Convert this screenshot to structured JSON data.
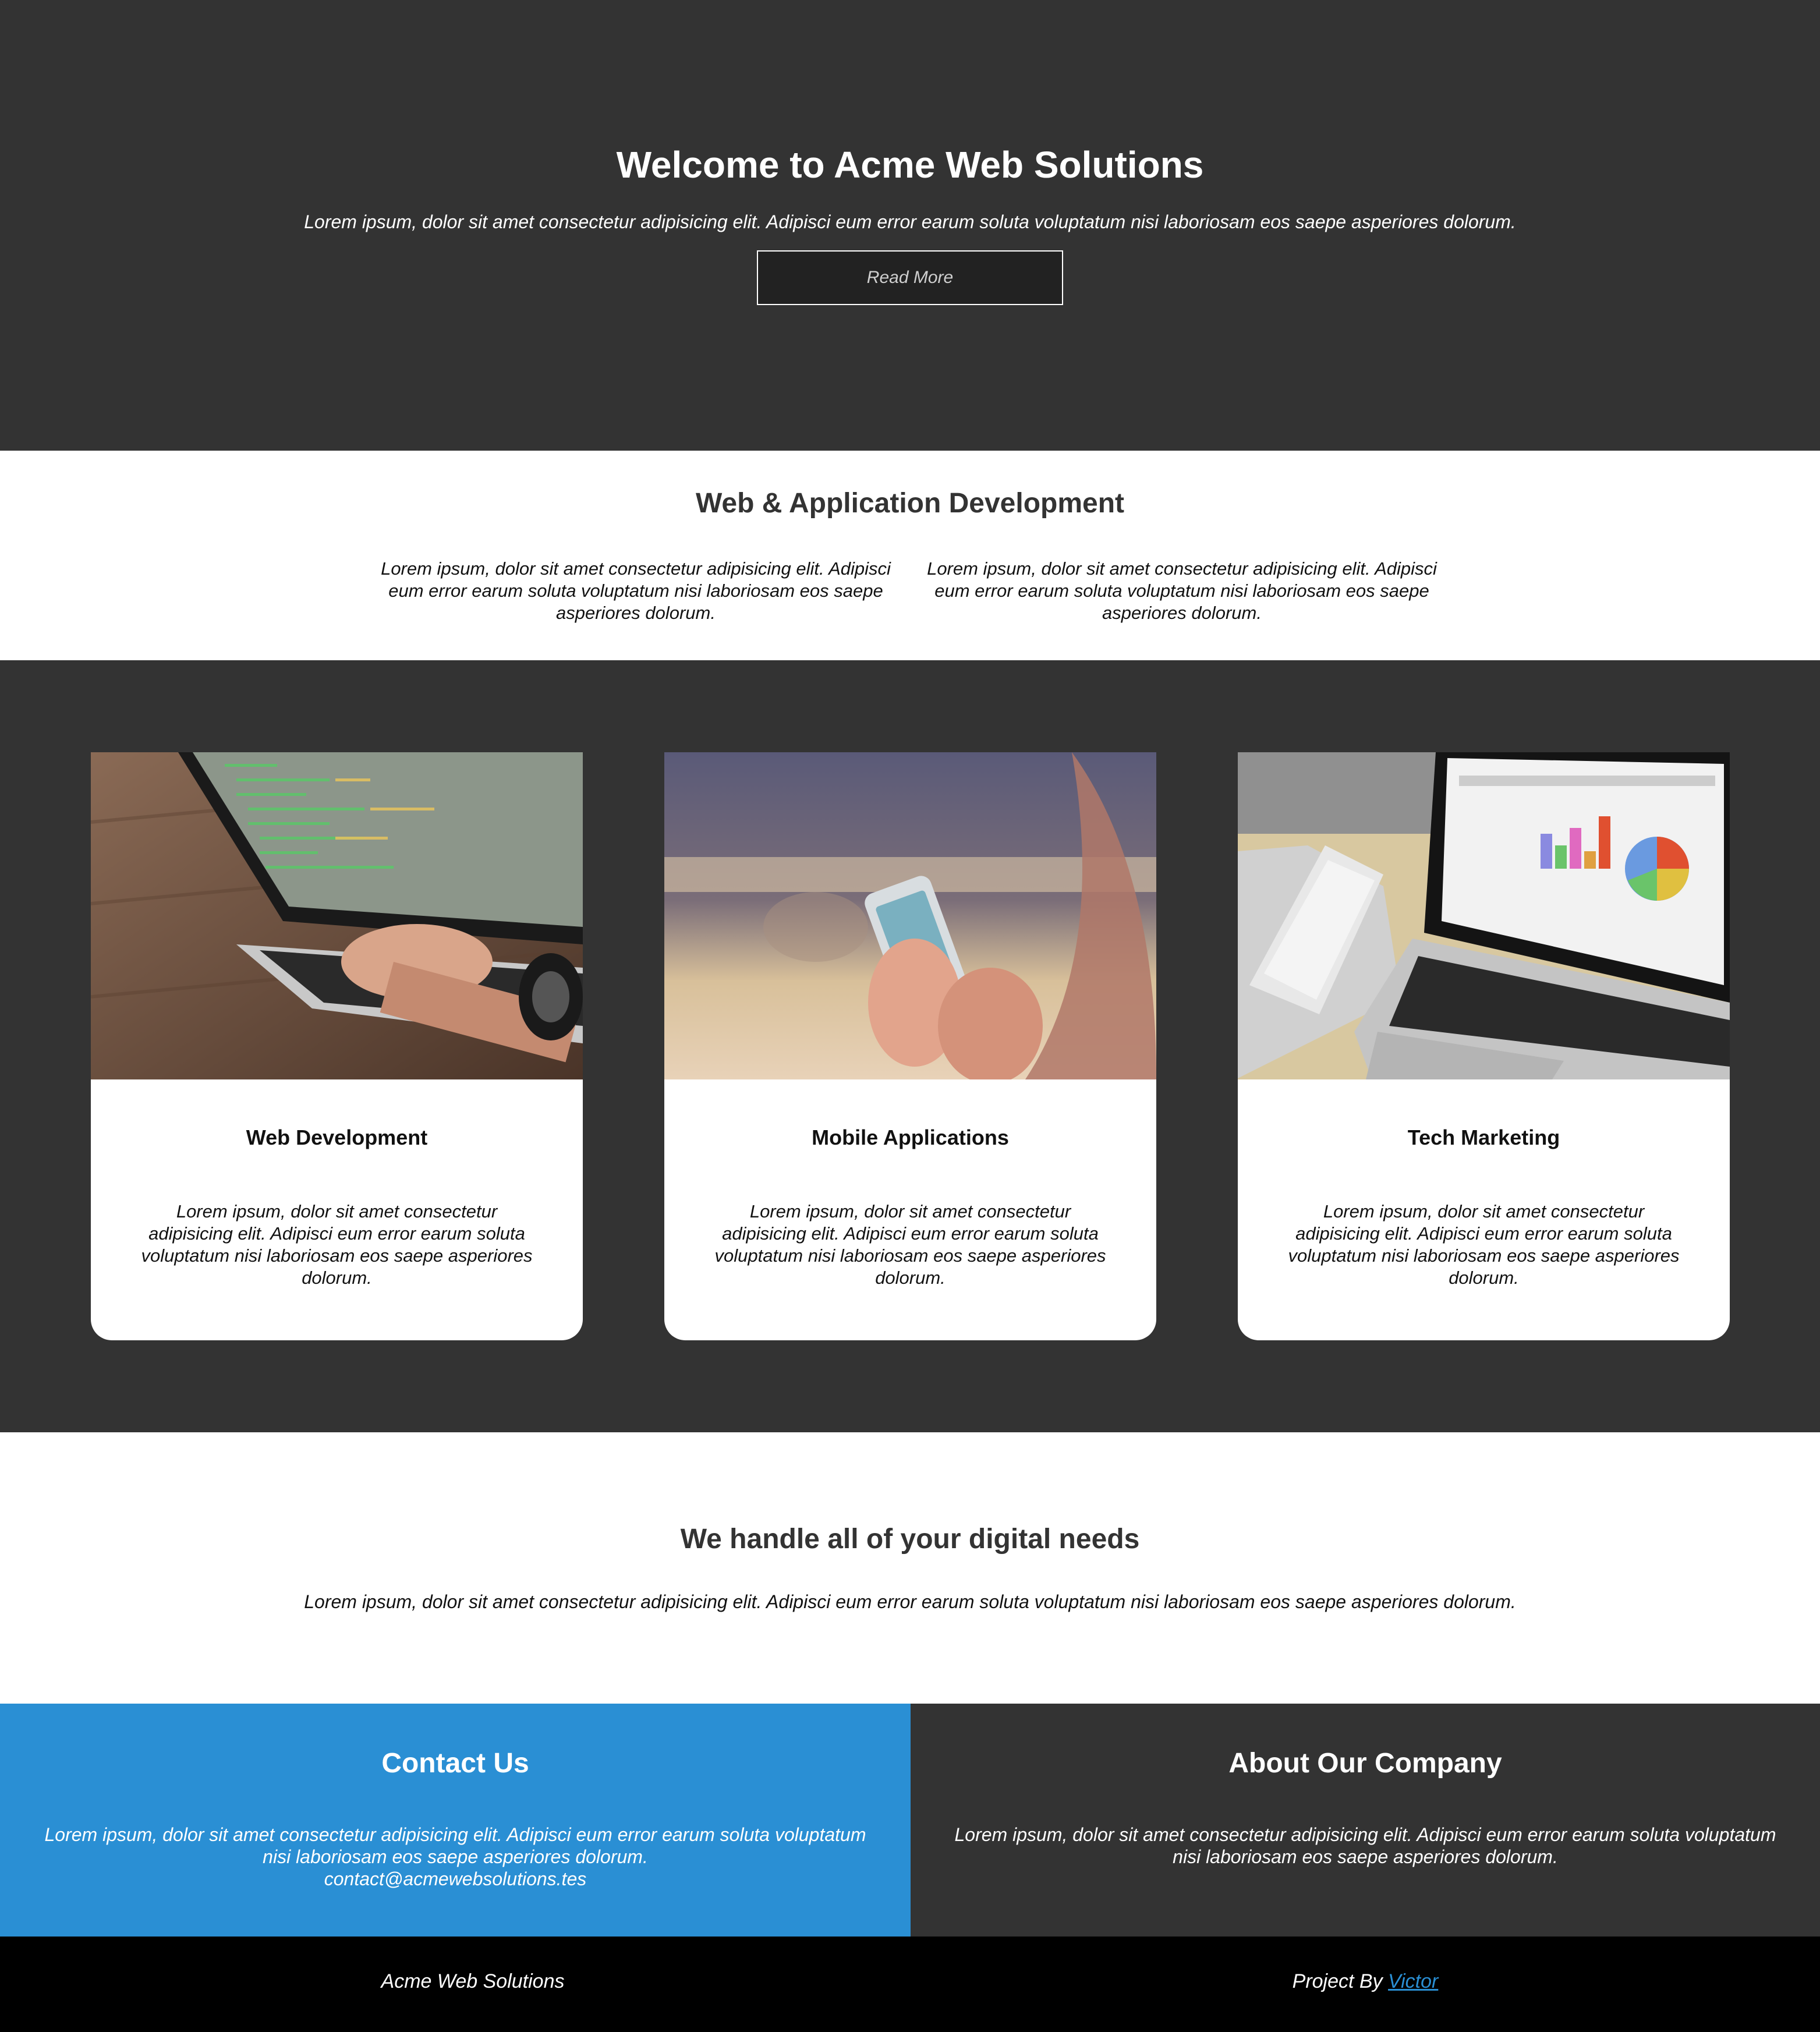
{
  "hero": {
    "title": "Welcome to Acme Web Solutions",
    "subtitle": "Lorem ipsum, dolor sit amet consectetur adipisicing elit. Adipisci eum error earum soluta voluptatum nisi laboriosam eos saepe asperiores dolorum.",
    "button_label": "Read More"
  },
  "development": {
    "title": "Web & Application Development",
    "columns": [
      "Lorem ipsum, dolor sit amet consectetur adipisicing elit. Adipisci eum error earum soluta voluptatum nisi laboriosam eos saepe asperiores dolorum.",
      "Lorem ipsum, dolor sit amet consectetur adipisicing elit. Adipisci eum error earum soluta voluptatum nisi laboriosam eos saepe asperiores dolorum."
    ]
  },
  "cards": [
    {
      "title": "Web Development",
      "text": "Lorem ipsum, dolor sit amet consectetur adipisicing elit. Adipisci eum error earum soluta voluptatum nisi laboriosam eos saepe asperiores dolorum.",
      "image": "laptop-coding-photo"
    },
    {
      "title": "Mobile Applications",
      "text": "Lorem ipsum, dolor sit amet consectetur adipisicing elit. Adipisci eum error earum soluta voluptatum nisi laboriosam eos saepe asperiores dolorum.",
      "image": "phone-in-hands-photo"
    },
    {
      "title": "Tech Marketing",
      "text": "Lorem ipsum, dolor sit amet consectetur adipisicing elit. Adipisci eum error earum soluta voluptatum nisi laboriosam eos saepe asperiores dolorum.",
      "image": "laptop-charts-tablet-photo"
    }
  ],
  "needs": {
    "title": "We handle all of your digital needs",
    "text": "Lorem ipsum, dolor sit amet consectetur adipisicing elit. Adipisci eum error earum soluta voluptatum nisi laboriosam eos saepe asperiores dolorum."
  },
  "contact": {
    "title": "Contact Us",
    "text": "Lorem ipsum, dolor sit amet consectetur adipisicing elit. Adipisci eum error earum soluta voluptatum nisi laboriosam eos saepe asperiores dolorum.",
    "email": "contact@acmewebsolutions.tes"
  },
  "about": {
    "title": "About Our Company",
    "text": "Lorem ipsum, dolor sit amet consectetur adipisicing elit. Adipisci eum error earum soluta voluptatum nisi laboriosam eos saepe asperiores dolorum."
  },
  "footer": {
    "brand": "Acme Web Solutions",
    "credit_prefix": "Project By",
    "credit_link": "Victor"
  },
  "colors": {
    "dark": "#333333",
    "accent_blue": "#2a8fd4",
    "footer_black": "#000000"
  }
}
